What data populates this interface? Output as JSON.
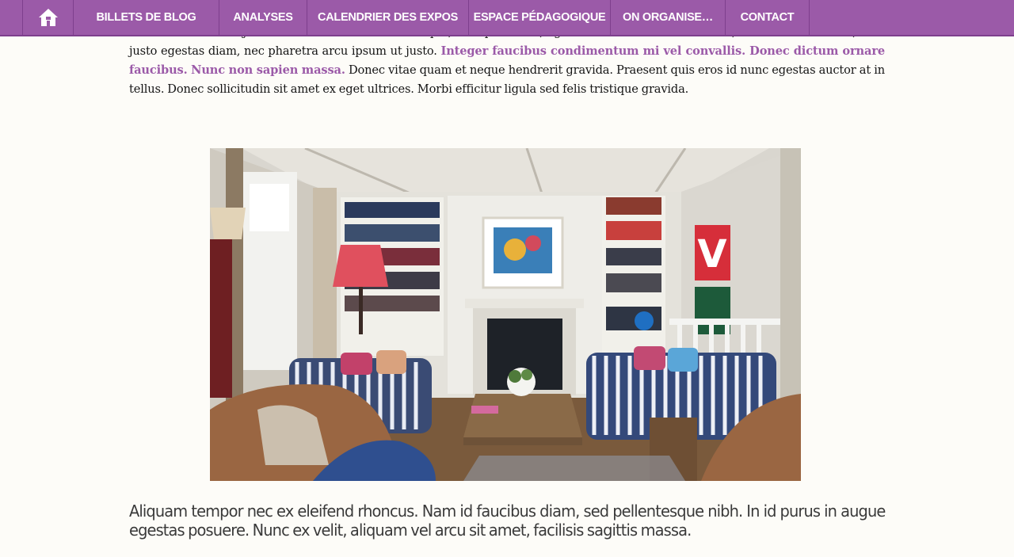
{
  "nav": {
    "home_icon": "home-icon",
    "items": [
      {
        "label": "BILLETS DE BLOG"
      },
      {
        "label": "ANALYSES"
      },
      {
        "label": "CALENDRIER DES EXPOS"
      },
      {
        "label": "ESPACE PÉDAGOGIQUE"
      },
      {
        "label": "ON ORGANISE…"
      },
      {
        "label": "CONTACT"
      }
    ]
  },
  "article": {
    "intro_line1": "non ultricies libero justo at elit. Ut vel nisi ullamcorper, suscipit elit ac, egestas nisl. Mauris elementum, nisi a finibus luctus, eros justo egestas diam, nec pharetra arcu ipsum ut justo.",
    "intro_highlight": "Integer faucibus condimentum mi vel convallis. Donec dictum ornare faucibus. Nunc non sapien massa.",
    "intro_line2": "Donec vitae quam et neque hendrerit gravida. Praesent quis eros id nunc egestas auctor at in tellus. Donec sollicitudin sit amet ex eget ultrices. Morbi efficitur ligula sed felis tristique gravida.",
    "subheading": "Aliquam tempor nec ex eleifend rhoncus. Nam id faucibus diam, sed pellentesque nibh. In id purus in augue egestas posuere. Nunc ex velit, aliquam vel arcu sit amet, facilisis sagittis massa."
  },
  "colors": {
    "brand": "#9b5aa8",
    "nav_border": "#7e3f8d",
    "page_bg": "#fdfcf8",
    "text": "#141414",
    "heading": "#3a3a3a"
  }
}
